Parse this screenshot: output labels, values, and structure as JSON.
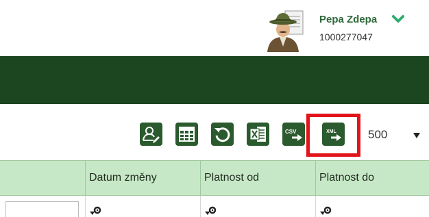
{
  "user": {
    "name": "Pepa Zdepa",
    "id": "1000277047"
  },
  "toolbar": {
    "buttons": [
      {
        "icon": "user-edit-icon"
      },
      {
        "icon": "table-grid-icon"
      },
      {
        "icon": "refresh-icon"
      },
      {
        "icon": "excel-export-icon"
      },
      {
        "icon": "csv-export-icon",
        "label": "CSV"
      },
      {
        "icon": "xml-export-icon",
        "label": "XML"
      }
    ],
    "page_size": "500"
  },
  "table": {
    "columns": [
      "",
      "Datum změny",
      "Platnost od",
      "Platnost do"
    ]
  },
  "colors": {
    "header_bar": "#1b4620",
    "button": "#2a5a2e",
    "table_header": "#c7e8c6",
    "highlight": "#e1141b",
    "user_name": "#2d6a3a"
  }
}
